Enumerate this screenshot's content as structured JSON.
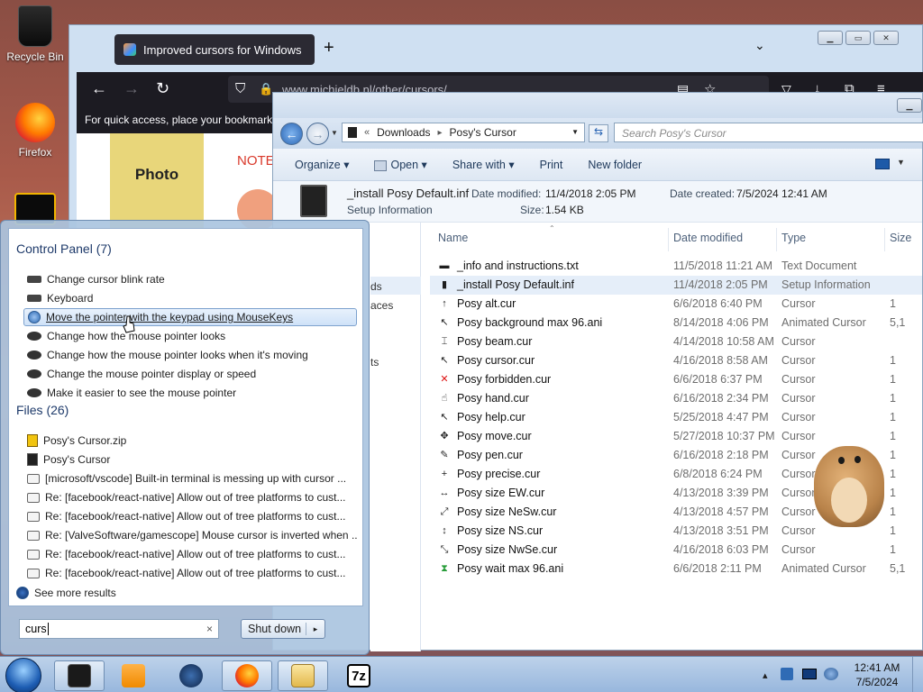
{
  "desktop": {
    "icons": [
      {
        "label": "Recycle Bin",
        "icon": "recycle-bin-icon"
      },
      {
        "label": "Firefox",
        "icon": "firefox-icon"
      }
    ]
  },
  "browser": {
    "tab_title": "Improved cursors for Windows",
    "new_tab": "+",
    "url": "www.michieldb.nl/other/cursors/",
    "bookmarks_hint": "For quick access, place your bookmarks",
    "page": {
      "photo_label": "Photo",
      "note_label": "NOTE"
    }
  },
  "explorer": {
    "address": {
      "root": "Downloads",
      "sep": "▸",
      "current": "Posy's Cursor"
    },
    "search_placeholder": "Search Posy's Cursor",
    "commands": {
      "organize": "Organize",
      "open": "Open",
      "share_with": "Share with",
      "print": "Print",
      "new_folder": "New folder"
    },
    "details": {
      "filename": "_install Posy Default.inf",
      "modified_label": "Date modified:",
      "modified_value": "11/4/2018 2:05 PM",
      "created_label": "Date created:",
      "created_value": "7/5/2024 12:41 AM",
      "type": "Setup Information",
      "size_label": "Size:",
      "size_value": "1.54 KB"
    },
    "nav_fragments": [
      "ds",
      "aces",
      "ts"
    ],
    "columns": {
      "name": "Name",
      "date": "Date modified",
      "type": "Type",
      "size": "Size"
    },
    "files": [
      {
        "name": "_info and instructions.txt",
        "date": "11/5/2018 11:21 AM",
        "type": "Text Document",
        "size": "",
        "icon": "text-file-icon"
      },
      {
        "name": "_install Posy Default.inf",
        "date": "11/4/2018 2:05 PM",
        "type": "Setup Information",
        "size": "",
        "icon": "setup-file-icon"
      },
      {
        "name": "Posy alt.cur",
        "date": "6/6/2018 6:40 PM",
        "type": "Cursor",
        "size": "1",
        "icon": "alt-cursor-icon"
      },
      {
        "name": "Posy background max 96.ani",
        "date": "8/14/2018 4:06 PM",
        "type": "Animated Cursor",
        "size": "5,1",
        "icon": "background-cursor-icon"
      },
      {
        "name": "Posy beam.cur",
        "date": "4/14/2018 10:58 AM",
        "type": "Cursor",
        "size": "",
        "icon": "beam-cursor-icon"
      },
      {
        "name": "Posy cursor.cur",
        "date": "4/16/2018 8:58 AM",
        "type": "Cursor",
        "size": "1",
        "icon": "arrow-cursor-icon"
      },
      {
        "name": "Posy forbidden.cur",
        "date": "6/6/2018 6:37 PM",
        "type": "Cursor",
        "size": "1",
        "icon": "forbidden-cursor-icon"
      },
      {
        "name": "Posy hand.cur",
        "date": "6/16/2018 2:34 PM",
        "type": "Cursor",
        "size": "1",
        "icon": "hand-cursor-icon"
      },
      {
        "name": "Posy help.cur",
        "date": "5/25/2018 4:47 PM",
        "type": "Cursor",
        "size": "1",
        "icon": "help-cursor-icon"
      },
      {
        "name": "Posy move.cur",
        "date": "5/27/2018 10:37 PM",
        "type": "Cursor",
        "size": "1",
        "icon": "move-cursor-icon"
      },
      {
        "name": "Posy pen.cur",
        "date": "6/16/2018 2:18 PM",
        "type": "Cursor",
        "size": "1",
        "icon": "pen-cursor-icon"
      },
      {
        "name": "Posy precise.cur",
        "date": "6/8/2018 6:24 PM",
        "type": "Cursor",
        "size": "1",
        "icon": "precise-cursor-icon"
      },
      {
        "name": "Posy size EW.cur",
        "date": "4/13/2018 3:39 PM",
        "type": "Cursor",
        "size": "1",
        "icon": "size-ew-cursor-icon"
      },
      {
        "name": "Posy size NeSw.cur",
        "date": "4/13/2018 4:57 PM",
        "type": "Cursor",
        "size": "1",
        "icon": "size-nesw-cursor-icon"
      },
      {
        "name": "Posy size NS.cur",
        "date": "4/13/2018 3:51 PM",
        "type": "Cursor",
        "size": "1",
        "icon": "size-ns-cursor-icon"
      },
      {
        "name": "Posy size NwSe.cur",
        "date": "4/16/2018 6:03 PM",
        "type": "Cursor",
        "size": "1",
        "icon": "size-nwse-cursor-icon"
      },
      {
        "name": "Posy wait max 96.ani",
        "date": "6/6/2018 2:11 PM",
        "type": "Animated Cursor",
        "size": "5,1",
        "icon": "wait-cursor-icon"
      }
    ]
  },
  "start_menu": {
    "control_panel_header": "Control Panel (7)",
    "control_panel_items": [
      {
        "label": "Change cursor blink rate",
        "icon": "keyboard-icon"
      },
      {
        "label": "Keyboard",
        "icon": "keyboard-icon"
      },
      {
        "label": "Move the pointer with the keypad using MouseKeys",
        "icon": "ease-of-access-icon"
      },
      {
        "label": "Change how the mouse pointer looks",
        "icon": "mouse-icon"
      },
      {
        "label": "Change how the mouse pointer looks when it's moving",
        "icon": "mouse-icon"
      },
      {
        "label": "Change the mouse pointer display or speed",
        "icon": "mouse-icon"
      },
      {
        "label": "Make it easier to see the mouse pointer",
        "icon": "mouse-icon"
      }
    ],
    "files_header": "Files (26)",
    "file_items": [
      {
        "label": "Posy's Cursor.zip",
        "icon": "zip-icon"
      },
      {
        "label": "Posy's Cursor",
        "icon": "folder-icon"
      },
      {
        "label": "[microsoft/vscode] Built-in terminal is messing up with cursor ...",
        "icon": "email-icon"
      },
      {
        "label": "Re: [facebook/react-native] Allow out of tree platforms to cust...",
        "icon": "email-icon"
      },
      {
        "label": "Re: [facebook/react-native] Allow out of tree platforms to cust...",
        "icon": "email-icon"
      },
      {
        "label": "Re: [ValveSoftware/gamescope] Mouse cursor is inverted when ...",
        "icon": "email-icon"
      },
      {
        "label": "Re: [facebook/react-native] Allow out of tree platforms to cust...",
        "icon": "email-icon"
      },
      {
        "label": "Re: [facebook/react-native] Allow out of tree platforms to cust...",
        "icon": "email-icon"
      }
    ],
    "see_more": "See more results",
    "search_value": "curs",
    "clear": "×",
    "shutdown_label": "Shut down",
    "shutdown_arrow": "▸"
  },
  "taskbar": {
    "time": "12:41 AM",
    "date": "7/5/2024",
    "sevenzip_label": "7z",
    "tray_arrow": "▴"
  },
  "colors": {
    "selection": "#cfe2f8",
    "taskbar": "#98b7dd",
    "browser_dark": "#1c1b22"
  }
}
